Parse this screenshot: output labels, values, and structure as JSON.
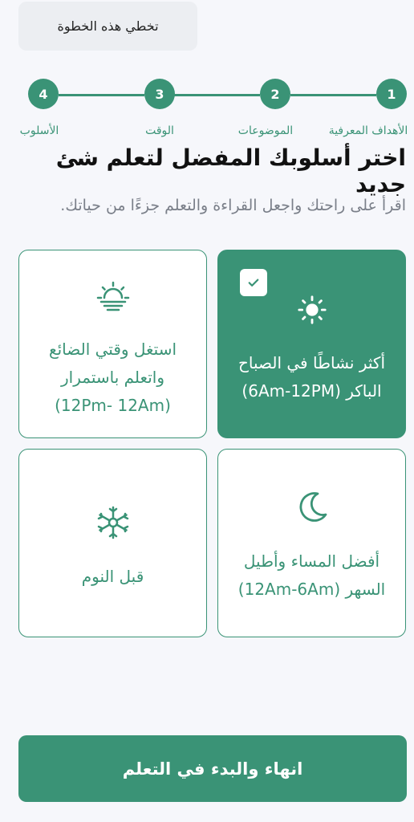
{
  "header": {
    "skip_label": "تخطي هذه الخطوة"
  },
  "stepper": {
    "steps": [
      {
        "number": "1",
        "label": "الأهداف المعرفية"
      },
      {
        "number": "2",
        "label": "الموضوعات"
      },
      {
        "number": "3",
        "label": "الوقت"
      },
      {
        "number": "4",
        "label": "الأسلوب"
      }
    ]
  },
  "main": {
    "title": "اختر أسلوبك المفضل لتعلم شئ جديد",
    "subtitle": "اقرأ على راحتك واجعل القراءة والتعلم جزءًا من حياتك.",
    "options": [
      {
        "label": "أكثر نشاطًا في الصباح\nالباكر (6Am-12PM)",
        "icon": "sun-icon",
        "selected": true
      },
      {
        "label": "استغل وقتي الضائع\nواتعلم باستمرار\n(12Pm- 12Am)",
        "icon": "sunrise-icon",
        "selected": false
      },
      {
        "label": "أفضل المساء وأطيل\nالسهر  (12Am-6Am)",
        "icon": "moon-icon",
        "selected": false
      },
      {
        "label": "قبل النوم",
        "icon": "snowflake-icon",
        "selected": false
      }
    ]
  },
  "footer": {
    "finish_label": "انهاء والبدء في التعلم"
  },
  "colors": {
    "accent": "#3a9376",
    "background": "#f6f7fb"
  }
}
